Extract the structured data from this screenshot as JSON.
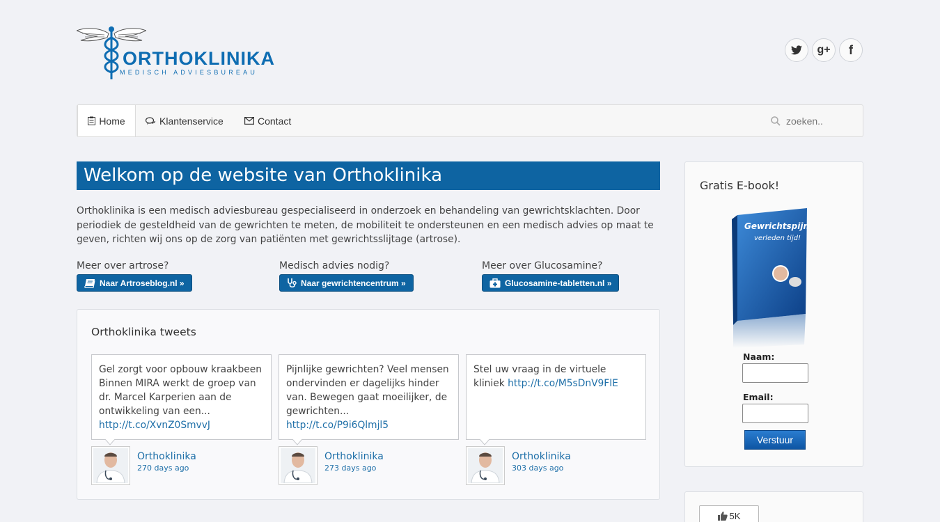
{
  "brand": {
    "name": "ORTHOKLINIKA",
    "tagline": "MEDISCH ADVIESBUREAU",
    "color": "#0f6db2"
  },
  "social": [
    {
      "name": "twitter",
      "glyph": "t-icon"
    },
    {
      "name": "google-plus",
      "label": "g+"
    },
    {
      "name": "facebook",
      "label": "f"
    }
  ],
  "nav": {
    "items": [
      {
        "label": "Home",
        "icon": "clipboard-icon",
        "active": true
      },
      {
        "label": "Klantenservice",
        "icon": "comments-icon"
      },
      {
        "label": "Contact",
        "icon": "envelope-icon"
      }
    ],
    "search_placeholder": "zoeken.."
  },
  "main": {
    "title": "Welkom op de website van Orthoklinika",
    "intro": "Orthoklinika is een medisch adviesbureau gespecialiseerd in onderzoek en behandeling van gewrichtsklachten. Door periodiek de gesteldheid van de gewrichten te meten, de mobiliteit te ondersteunen en een medisch advies op maat te geven, richten wij ons op de zorg van patiënten met gewrichtsslijtage (artrose).",
    "cta": [
      {
        "label": "Meer over artrose?",
        "button": "Naar Artroseblog.nl »",
        "icon": "book-icon"
      },
      {
        "label": "Medisch advies nodig?",
        "button": "Naar gewrichtencentrum »",
        "icon": "stethoscope-icon"
      },
      {
        "label": "Meer over Glucosamine?",
        "button": "Glucosamine-tabletten.nl »",
        "icon": "medkit-icon"
      }
    ]
  },
  "tweets": {
    "title": "Orthoklinika tweets",
    "items": [
      {
        "text": "Gel zorgt voor opbouw kraakbeen Binnen MIRA werkt de groep van dr. Marcel Karperien aan de ontwikkeling van een...",
        "link": "http://t.co/XvnZ0SmvvJ",
        "author": "Orthoklinika",
        "time": "270 days ago"
      },
      {
        "text": "Pijnlijke gewrichten? Veel mensen ondervinden er dagelijks hinder van. Bewegen gaat moeilijker, de gewrichten...",
        "link": "http://t.co/P9i6Qlmjl5",
        "author": "Orthoklinika",
        "time": "273 days ago"
      },
      {
        "text": "Stel uw vraag in de virtuele kliniek",
        "link": "http://t.co/M5sDnV9FlE",
        "author": "Orthoklinika",
        "time": "303 days ago"
      }
    ]
  },
  "sidebar": {
    "ebook_title": "Gratis E-book!",
    "book_title_line1": "Gewrichtspijn",
    "book_title_line2": "verleden tijd!",
    "name_label": "Naam:",
    "email_label": "Email:",
    "submit_label": "Verstuur",
    "like_count": "5K"
  },
  "colors": {
    "accent": "#0e64a2",
    "link": "#1e6fa8",
    "background": "#f1f2f6"
  }
}
